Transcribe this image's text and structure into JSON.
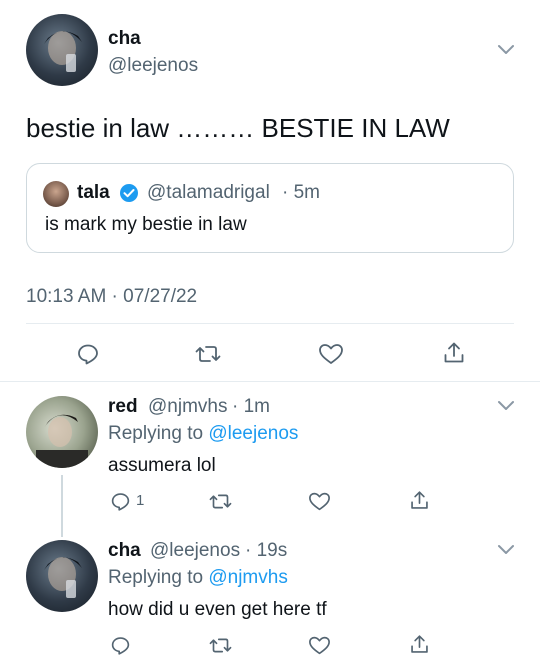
{
  "main_tweet": {
    "display_name": "cha",
    "handle": "@leejenos",
    "text": "bestie in law ……… BESTIE IN LAW",
    "timestamp": "10:13 AM · 07/27/22",
    "quote": {
      "display_name": "tala",
      "handle": "@talamadrigal",
      "time": "· 5m",
      "text": "is mark my bestie in law"
    }
  },
  "replies": [
    {
      "display_name": "red",
      "handle": "@njmvhs",
      "time": "· 1m",
      "replying_prefix": "Replying to",
      "replying_to": "@leejenos",
      "text": "assumera lol",
      "reply_count": "1"
    },
    {
      "display_name": "cha",
      "handle": "@leejenos",
      "time": "· 19s",
      "replying_prefix": "Replying to",
      "replying_to": "@njmvhs",
      "text": "how did u even get here tf",
      "reply_count": ""
    }
  ],
  "colors": {
    "accent": "#1d9bf0",
    "text": "#0f1419",
    "secondary": "#536471",
    "border": "#e6ecf0"
  },
  "icons": [
    "reply-icon",
    "retweet-icon",
    "like-icon",
    "share-icon",
    "chevron-down-icon",
    "verified-badge-icon"
  ]
}
